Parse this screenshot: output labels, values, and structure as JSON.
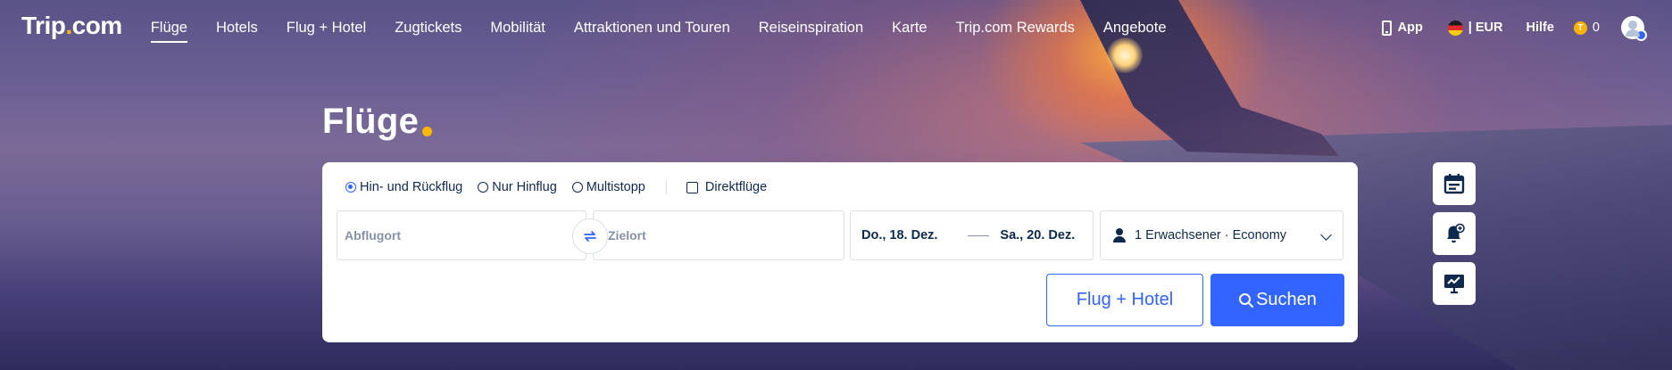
{
  "brand": {
    "logo_left": "Trip",
    "logo_dot": ".",
    "logo_right": "com"
  },
  "nav": {
    "items": [
      {
        "label": "Flüge",
        "active": true
      },
      {
        "label": "Hotels"
      },
      {
        "label": "Flug + Hotel"
      },
      {
        "label": "Zugtickets"
      },
      {
        "label": "Mobilität"
      },
      {
        "label": "Attraktionen und Touren"
      },
      {
        "label": "Reiseinspiration"
      },
      {
        "label": "Karte"
      },
      {
        "label": "Trip.com Rewards"
      },
      {
        "label": "Angebote"
      }
    ],
    "right": {
      "app_label": "App",
      "currency_label": "| EUR",
      "help_label": "Hilfe",
      "coins_count": "0"
    }
  },
  "page": {
    "title": "Flüge"
  },
  "search": {
    "trip_types": [
      {
        "label": "Hin- und Rückflug",
        "checked": true
      },
      {
        "label": "Nur Hinflug",
        "checked": false
      },
      {
        "label": "Multistopp",
        "checked": false
      }
    ],
    "direct_label": "Direktflüge",
    "from_placeholder": "Abflugort",
    "to_placeholder": "Zielort",
    "depart_date": "Do., 18. Dez.",
    "return_date": "Sa., 20. Dez.",
    "passengers": "1 Erwachsener · Economy",
    "flight_hotel_button": "Flug + Hotel",
    "search_button": "Suchen"
  },
  "icons": {
    "phone": "phone-icon",
    "flag": "germany-flag-icon",
    "coin": "coin-icon",
    "avatar": "avatar-icon",
    "swap": "swap-icon",
    "person": "person-icon",
    "chevron": "chevron-down-icon",
    "search": "search-icon",
    "side_tools": [
      "calendar-icon",
      "price-alert-bell-icon",
      "price-trend-icon"
    ]
  },
  "colors": {
    "primary": "#3264ff",
    "brand_dot": "#ffb800",
    "text": "#0f294d"
  }
}
